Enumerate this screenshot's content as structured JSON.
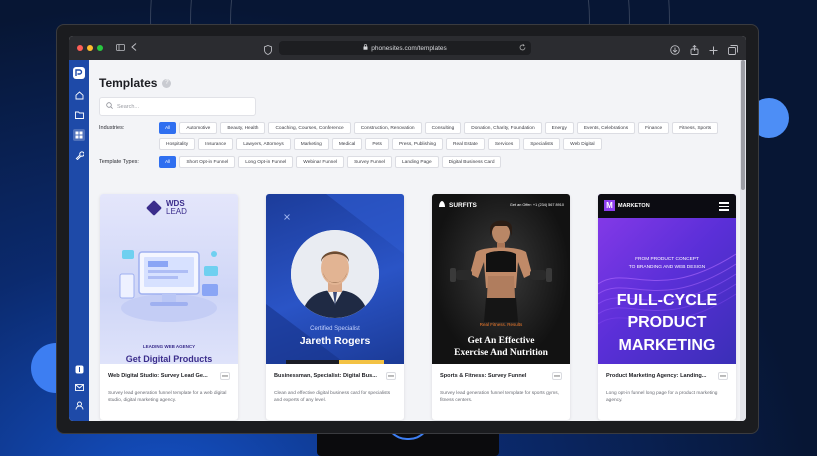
{
  "browser": {
    "url": "phonesites.com/templates"
  },
  "page": {
    "title": "Templates",
    "help_glyph": "?"
  },
  "search": {
    "placeholder": "Search..."
  },
  "filters": {
    "industries_label": "Industries:",
    "industries": [
      "All",
      "Automotive",
      "Beauty, Health",
      "Coaching, Courses, Conference",
      "Construction, Renovation",
      "Consulting",
      "Donation, Charity, Foundation",
      "Energy",
      "Events, Celebrations",
      "Finance",
      "Fitness, Sports",
      "Hospitality",
      "Insurance",
      "Lawyers, Attorneys",
      "Marketing",
      "Medical",
      "Pets",
      "Press, Publishing",
      "Real Estate",
      "Services",
      "Specialists",
      "Web Digital"
    ],
    "types_label": "Template Types:",
    "types": [
      "All",
      "Short Opt-in Funnel",
      "Long Opt-in Funnel",
      "Webinar Funnel",
      "Survey Funnel",
      "Landing Page",
      "Digital Business Card"
    ]
  },
  "cards": [
    {
      "title": "Web Digital Studio: Survey Lead Ge...",
      "description": "Survey lead generation funnel template for a web digital studio, digital marketing agency.",
      "thumb": {
        "logo_line1": "WDS",
        "logo_line2": "LEAD",
        "sub1": "LEADING WEB AGENCY",
        "sub2": "Get Digital Products"
      }
    },
    {
      "title": "Businessman, Specialist: Digital Bus...",
      "description": "Clean and effective digital business card for specialists and experts of any level.",
      "thumb": {
        "certified": "Certified Specialist",
        "name": "Jareth Rogers"
      }
    },
    {
      "title": "Sports & Fitness: Survey Funnel",
      "description": "Survey lead generation funnel template for sports gyms, fitness centers.",
      "thumb": {
        "brand": "SURFITS",
        "offer": "Get an Offer: +1 (234) 567 8910",
        "realfit": "Real Fitness. Results",
        "headline1": "Get An Effective",
        "headline2": "Exercise And Nutrition"
      }
    },
    {
      "title": "Product Marketing Agency: Landing...",
      "description": "Long opt-in funnel long page for a product marketing agency.",
      "thumb": {
        "brand": "MARKETON",
        "brand_letter": "M",
        "tag1": "FROM PRODUCT CONCEPT",
        "tag2": "TO BRANDING AND WEB DESIGN",
        "big1": "FULL-CYCLE",
        "big2": "PRODUCT",
        "big3": "MARKETING"
      }
    }
  ],
  "colors": {
    "accent": "#2f6ff0",
    "sidebar": "#1e4aa8"
  }
}
